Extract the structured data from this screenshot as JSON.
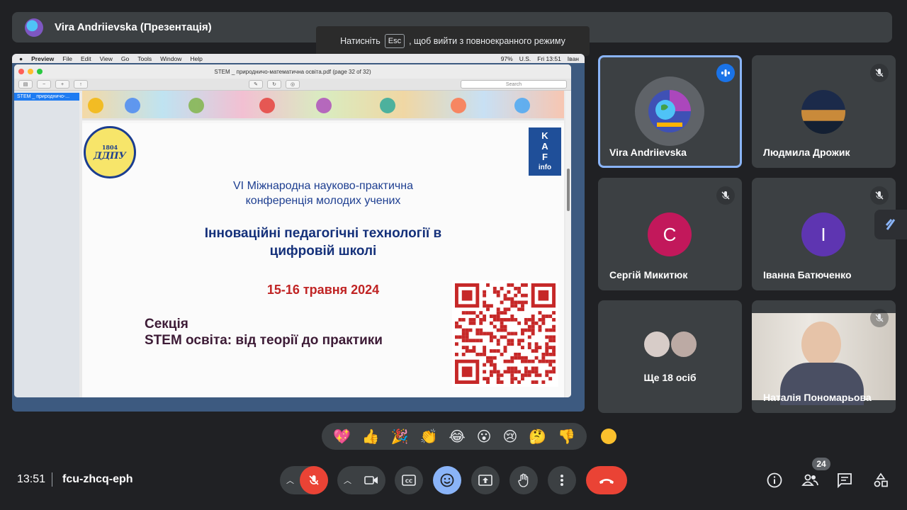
{
  "presenter_bar": {
    "title": "Vira Andriievska (Презентація)"
  },
  "esc_toast": {
    "before": "Натисніть",
    "key": "Esc",
    "after": ", щоб вийти з повноекранного режиму"
  },
  "mac_menubar": {
    "app": "Preview",
    "items": [
      "File",
      "Edit",
      "View",
      "Go",
      "Tools",
      "Window",
      "Help"
    ],
    "status": [
      "97%",
      "U.S.",
      "Fri 13:51",
      "Іван"
    ]
  },
  "preview": {
    "filename": "STEM _ природничо-математична освіта.pdf (page 32 of 32)",
    "search_placeholder": "Search",
    "sidebar_item": "STEM _ природничо-..."
  },
  "slide": {
    "logo_year": "1804",
    "logo_abbr": "ДДПУ",
    "kaf_lines": [
      "K",
      "A",
      "F",
      "info"
    ],
    "conf_line1": "VI Міжнародна науково-практична",
    "conf_line2": "конференція молодих учених",
    "topic_line1": "Інноваційні педагогічні технології в",
    "topic_line2": "цифровій школі",
    "dates": "15-16 травня 2024",
    "section_line1": "Секція",
    "section_line2": "STEM освіта: від теорії до практики"
  },
  "participants": [
    {
      "name": "Vira Andriievska",
      "speaking": true
    },
    {
      "name": "Людмила Дрожик",
      "muted": true
    },
    {
      "name": "Сергій Микитюк",
      "initial": "С",
      "color": "#c2185b",
      "muted": true
    },
    {
      "name": "Іванна Батюченко",
      "initial": "І",
      "color": "#5e35b1",
      "muted": true
    },
    {
      "name": "Ще 18 осіб"
    },
    {
      "name": "Наталія Пономарьова",
      "muted": true
    }
  ],
  "reactions": [
    "💖",
    "👍",
    "🎉",
    "👏",
    "😂",
    "😮",
    "😢",
    "🤔",
    "👎"
  ],
  "bottom_bar": {
    "time": "13:51",
    "meeting_code": "fcu-zhcq-eph",
    "people_count": "24"
  },
  "colors": {
    "background": "#202124",
    "tile": "#3c4043",
    "hangup": "#ea4335",
    "accent": "#8ab4f8",
    "speaking": "#1a73e8"
  }
}
